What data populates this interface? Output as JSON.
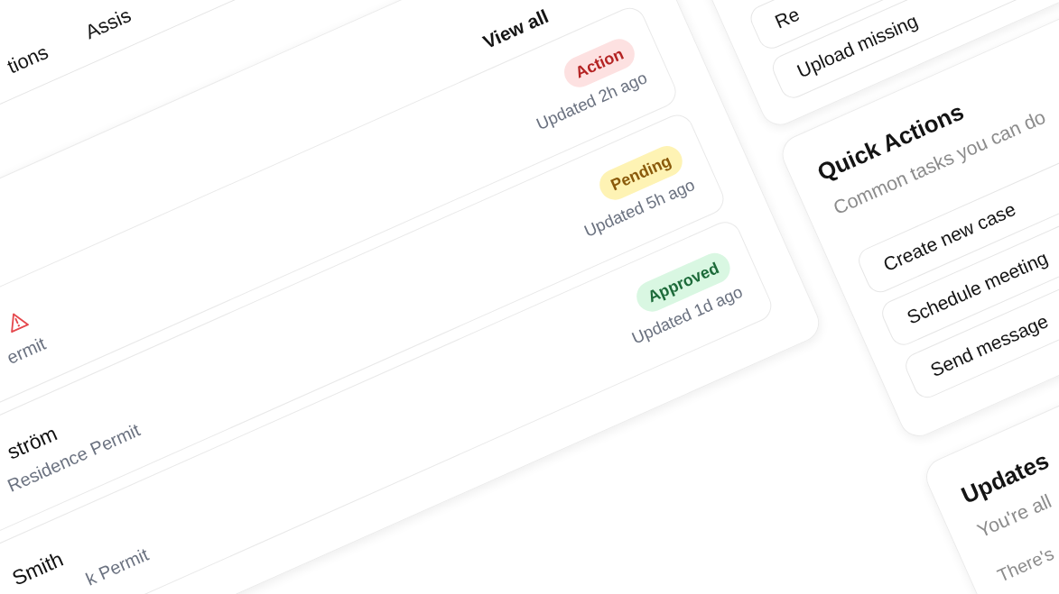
{
  "nav": {
    "items": [
      {
        "label": "tions"
      },
      {
        "label": "Assis"
      }
    ]
  },
  "main_card": {
    "link": "View all",
    "rows": [
      {
        "alert": true,
        "detail": "ermit",
        "badge": {
          "label": "Action",
          "kind": "danger"
        },
        "updated": "Updated 2h ago"
      },
      {
        "name": "ström",
        "alert": false,
        "detail": "Residence Permit",
        "badge": {
          "label": "Pending",
          "kind": "warning"
        },
        "updated": "Updated 5h ago"
      },
      {
        "name": "Smith",
        "alert": false,
        "detail": "k Permit",
        "badge": {
          "label": "Approved",
          "kind": "success"
        },
        "updated": "Updated 1d ago"
      }
    ]
  },
  "button_card": {
    "buttons": [
      "Re",
      "Upload missing"
    ]
  },
  "quick_actions": {
    "title": "Quick Actions",
    "subtitle": "Common tasks you can do",
    "buttons": [
      "Create new case",
      "Schedule meeting",
      "Send message"
    ]
  },
  "updates": {
    "title": "Updates",
    "subtitle": "You're all",
    "message": "There's"
  }
}
